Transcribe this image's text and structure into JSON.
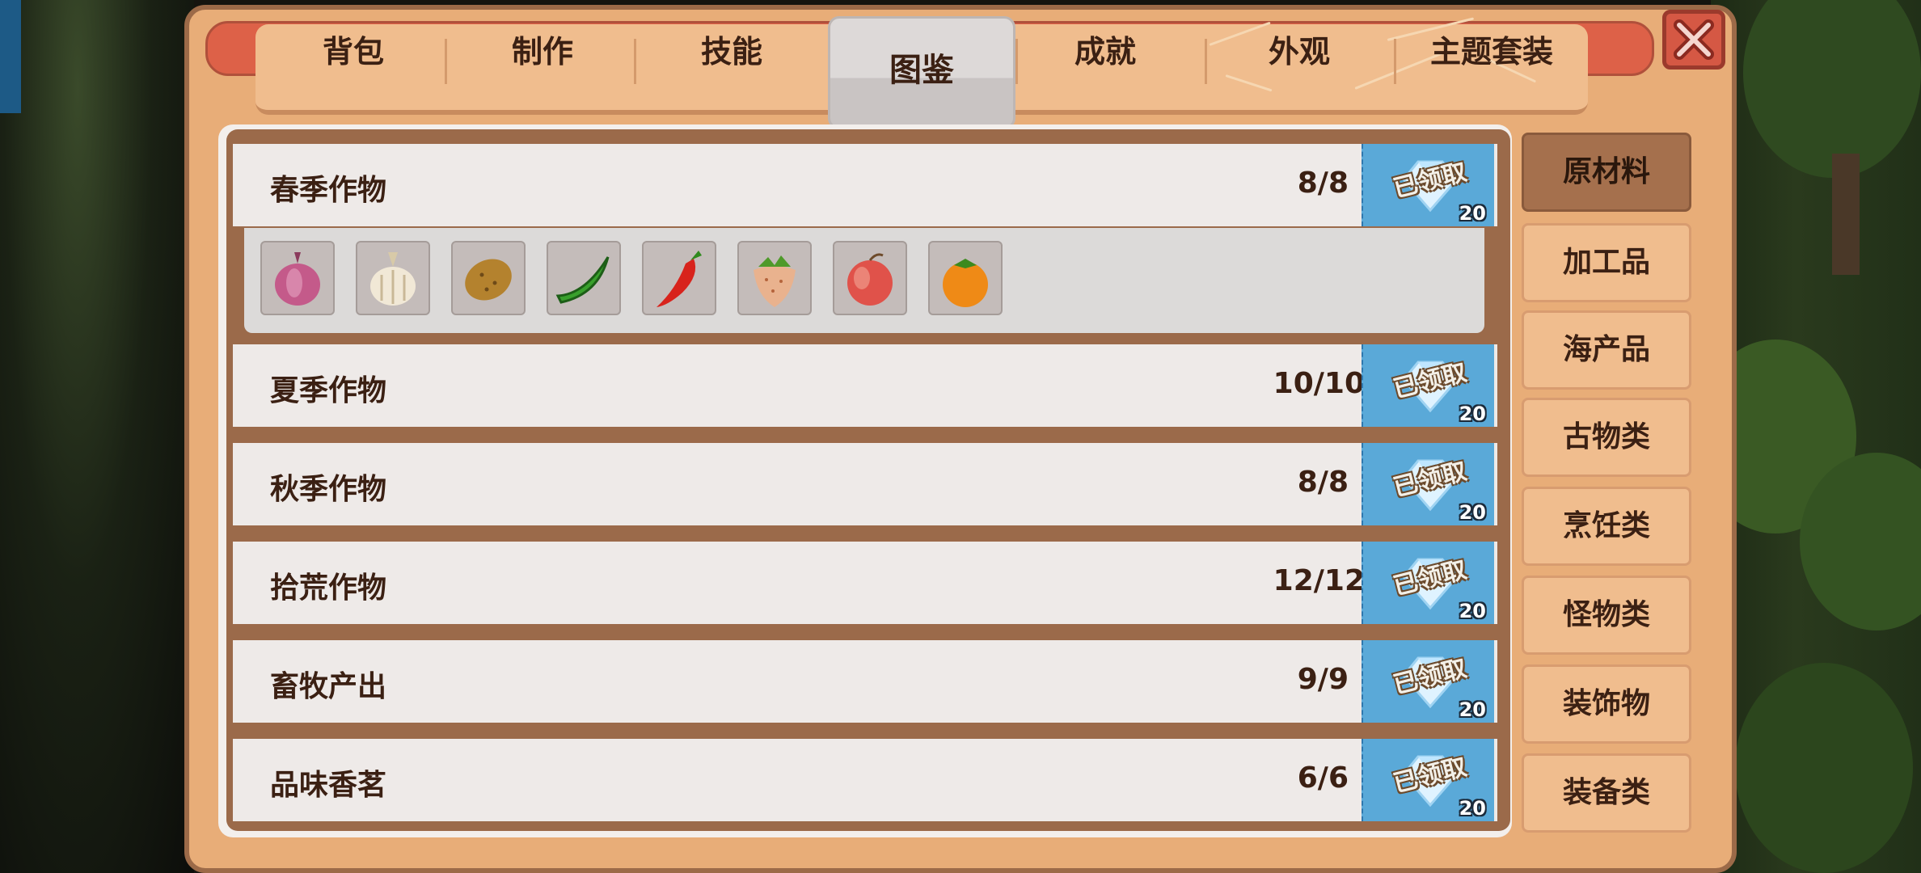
{
  "tabs": [
    {
      "label": "背包",
      "active": false
    },
    {
      "label": "制作",
      "active": false
    },
    {
      "label": "技能",
      "active": false
    },
    {
      "label": "图鉴",
      "active": true
    },
    {
      "label": "成就",
      "active": false
    },
    {
      "label": "外观",
      "active": false
    },
    {
      "label": "主题套装",
      "active": false
    }
  ],
  "categories": [
    {
      "label": "原材料",
      "selected": true
    },
    {
      "label": "加工品",
      "selected": false
    },
    {
      "label": "海产品",
      "selected": false
    },
    {
      "label": "古物类",
      "selected": false
    },
    {
      "label": "烹饪类",
      "selected": false
    },
    {
      "label": "怪物类",
      "selected": false
    },
    {
      "label": "装饰物",
      "selected": false
    },
    {
      "label": "装备类",
      "selected": false
    }
  ],
  "collections": [
    {
      "name": "春季作物",
      "progress": "8/8",
      "reward_status": "已领取",
      "reward_qty": "20",
      "expanded": true,
      "items": [
        "onion-icon",
        "garlic-icon",
        "potato-icon",
        "green-bean-icon",
        "red-pepper-icon",
        "strawberry-icon",
        "peach-icon",
        "orange-icon"
      ]
    },
    {
      "name": "夏季作物",
      "progress": "10/10",
      "reward_status": "已领取",
      "reward_qty": "20",
      "expanded": false
    },
    {
      "name": "秋季作物",
      "progress": "8/8",
      "reward_status": "已领取",
      "reward_qty": "20",
      "expanded": false
    },
    {
      "name": "拾荒作物",
      "progress": "12/12",
      "reward_status": "已领取",
      "reward_qty": "20",
      "expanded": false
    },
    {
      "name": "畜牧产出",
      "progress": "9/9",
      "reward_status": "已领取",
      "reward_qty": "20",
      "expanded": false
    },
    {
      "name": "品味香茗",
      "progress": "6/6",
      "reward_status": "已领取",
      "reward_qty": "20",
      "expanded": false
    }
  ],
  "colors": {
    "panel": "#e8ad78",
    "close_red": "#d55844",
    "reward_blue": "#5aa9d8",
    "selected_category": "#a5704d",
    "row_bg": "#eeeae8"
  }
}
